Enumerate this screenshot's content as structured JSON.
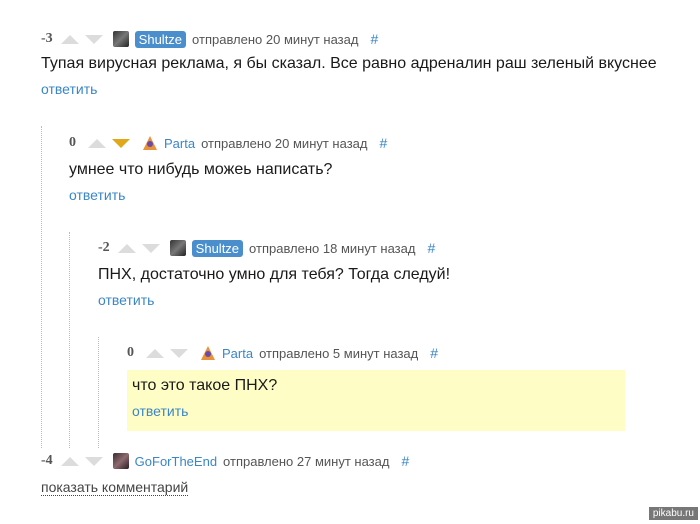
{
  "comments": [
    {
      "score": "-3",
      "user": "Shultze",
      "meta": "отправлено 20 минут назад",
      "hash": "#",
      "text": "Тупая вирусная реклама, я бы сказал. Все равно адреналин раш зеленый вкуснее",
      "reply": "ответить"
    },
    {
      "score": "0",
      "user": "Parta",
      "meta": "отправлено 20 минут назад",
      "hash": "#",
      "text": "умнее что нибудь можеь написать?",
      "reply": "ответить"
    },
    {
      "score": "-2",
      "user": "Shultze",
      "meta": "отправлено 18 минут назад",
      "hash": "#",
      "text": "ПНХ, достаточно умно для тебя? Тогда следуй!",
      "reply": "ответить"
    },
    {
      "score": "0",
      "user": "Parta",
      "meta": "отправлено 5 минут назад",
      "hash": "#",
      "text": "что это такое ПНХ?",
      "reply": "ответить"
    },
    {
      "score": "-4",
      "user": "GoForTheEnd",
      "meta": "отправлено 27 минут назад",
      "hash": "#"
    }
  ],
  "show_comment": "показать комментарий",
  "watermark": "pikabu.ru",
  "colors": {
    "link": "#3a86c6",
    "badge": "#4a8fcc",
    "highlight": "#fffdc6",
    "downvote_active": "#e0a81a",
    "arrow_inactive": "#dcdcdc"
  }
}
